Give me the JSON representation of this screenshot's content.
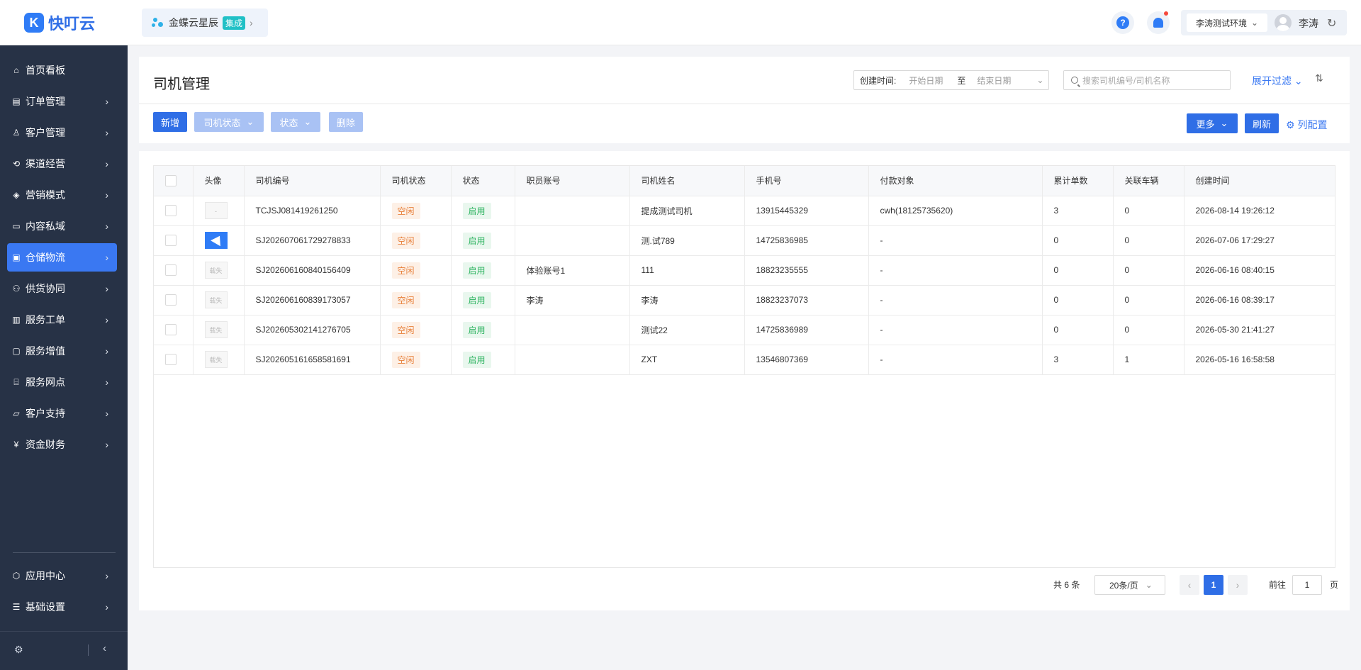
{
  "app": {
    "logo_glyph": "K",
    "name": "快叮云"
  },
  "brand": {
    "name": "金蝶云星辰",
    "tag": "集成"
  },
  "header": {
    "help_glyph": "?",
    "env": "李涛测试环境",
    "user": "李涛"
  },
  "sidebar": {
    "items": [
      {
        "label": "首页看板",
        "icon": "home-icon"
      },
      {
        "label": "订单管理",
        "icon": "clipboard-icon"
      },
      {
        "label": "客户管理",
        "icon": "user-icon"
      },
      {
        "label": "渠道经营",
        "icon": "share-icon"
      },
      {
        "label": "营销模式",
        "icon": "tag-icon"
      },
      {
        "label": "内容私域",
        "icon": "image-icon"
      },
      {
        "label": "仓储物流",
        "icon": "box-icon"
      },
      {
        "label": "供货协同",
        "icon": "people-icon"
      },
      {
        "label": "服务工单",
        "icon": "document-icon"
      },
      {
        "label": "服务增值",
        "icon": "bag-icon"
      },
      {
        "label": "服务网点",
        "icon": "store-icon"
      },
      {
        "label": "客户支持",
        "icon": "chat-icon"
      },
      {
        "label": "资金财务",
        "icon": "yen-icon"
      }
    ],
    "bottom": [
      {
        "label": "应用中心",
        "icon": "cube-icon"
      },
      {
        "label": "基础设置",
        "icon": "sliders-icon"
      }
    ],
    "active_index": 6
  },
  "page": {
    "title": "司机管理",
    "date_label": "创建时间:",
    "date_start": "开始日期",
    "date_to": "至",
    "date_end": "结束日期",
    "search_placeholder": "搜索司机编号/司机名称",
    "expand_filter": "展开过滤",
    "toolbar": {
      "add": "新增",
      "driver_status": "司机状态",
      "status": "状态",
      "delete": "删除",
      "more": "更多",
      "refresh": "刷新",
      "column_config": "列配置"
    }
  },
  "table": {
    "columns": [
      "头像",
      "司机编号",
      "司机状态",
      "状态",
      "职员账号",
      "司机姓名",
      "手机号",
      "付款对象",
      "累计单数",
      "关联车辆",
      "创建时间"
    ],
    "rows": [
      {
        "avatar": "-",
        "code": "TCJSJ081419261250",
        "driver_status": "空闲",
        "status": "启用",
        "staff": "",
        "name": "提成测试司机",
        "phone": "13915445329",
        "payee": "cwh(18125735620)",
        "orders": "3",
        "vehicles": "0",
        "created": "2026-08-14 19:26:12"
      },
      {
        "avatar": "",
        "code": "SJ202607061729278833",
        "driver_status": "空闲",
        "status": "启用",
        "staff": "",
        "name": "测.试789",
        "phone": "14725836985",
        "payee": "-",
        "orders": "0",
        "vehicles": "0",
        "created": "2026-07-06 17:29:27"
      },
      {
        "avatar": "载失",
        "code": "SJ202606160840156409",
        "driver_status": "空闲",
        "status": "启用",
        "staff": "体验账号1",
        "name": "111",
        "phone": "18823235555",
        "payee": "-",
        "orders": "0",
        "vehicles": "0",
        "created": "2026-06-16 08:40:15"
      },
      {
        "avatar": "载失",
        "code": "SJ202606160839173057",
        "driver_status": "空闲",
        "status": "启用",
        "staff": "李涛",
        "name": "李涛",
        "phone": "18823237073",
        "payee": "-",
        "orders": "0",
        "vehicles": "0",
        "created": "2026-06-16 08:39:17"
      },
      {
        "avatar": "载失",
        "code": "SJ202605302141276705",
        "driver_status": "空闲",
        "status": "启用",
        "staff": "",
        "name": "测试22",
        "phone": "14725836989",
        "payee": "-",
        "orders": "0",
        "vehicles": "0",
        "created": "2026-05-30 21:41:27"
      },
      {
        "avatar": "载失",
        "code": "SJ202605161658581691",
        "driver_status": "空闲",
        "status": "启用",
        "staff": "",
        "name": "ZXT",
        "phone": "13546807369",
        "payee": "-",
        "orders": "3",
        "vehicles": "1",
        "created": "2026-05-16 16:58:58"
      }
    ]
  },
  "pagination": {
    "total": "共 6 条",
    "page_size": "20条/页",
    "current": "1",
    "goto_label": "前往",
    "goto_value": "1",
    "page_suffix": "页"
  },
  "colors": {
    "primary": "#2f6ee6",
    "sidebar_bg": "#273246",
    "active": "#3a78f2",
    "idle_tag": "#e8813c",
    "on_tag": "#2bb35f"
  }
}
